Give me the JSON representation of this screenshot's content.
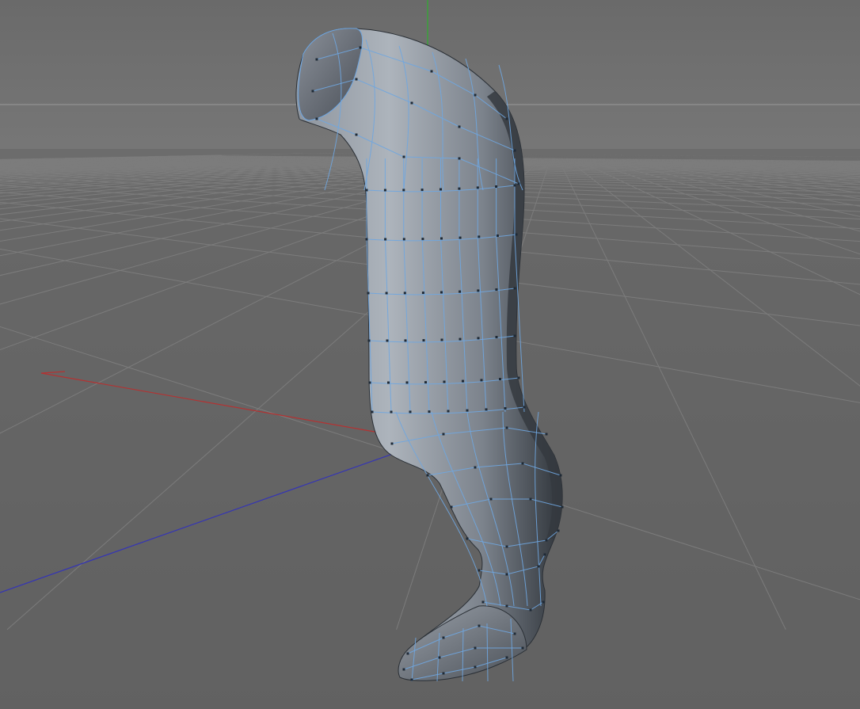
{
  "viewport": {
    "colors": {
      "background_top": "#6a6a6a",
      "background_horizon": "#737373",
      "floor": "#646464",
      "grid_line": "#7c7c7c",
      "grid_line_minor": "#6d6d6d",
      "horizon_line": "#9a9a9a",
      "axis_x": "#b43232",
      "axis_y": "#2fae2f",
      "axis_z": "#3535b4",
      "mesh_fill_light": "#a9b0b9",
      "mesh_fill_mid": "#7d848d",
      "mesh_fill_dark": "#3f444b",
      "mesh_wire": "#6fa6e0",
      "mesh_vertex": "#1f2a36"
    },
    "scene_objects": [
      "ground-grid-icon",
      "world-axis-x-icon",
      "world-axis-y-icon",
      "world-axis-z-icon",
      "leg-mesh-icon"
    ]
  }
}
